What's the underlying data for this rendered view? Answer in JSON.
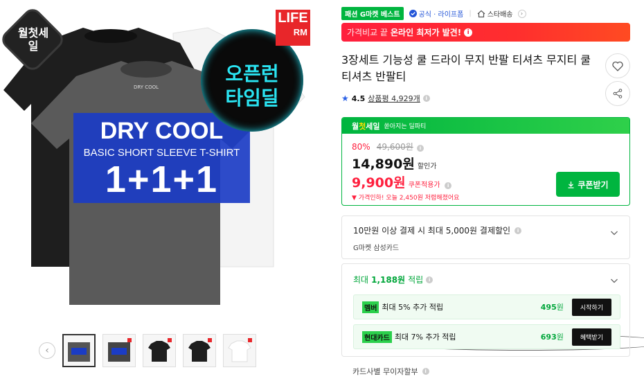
{
  "product_image": {
    "badge_main": "월첫세일",
    "badge_alarm_line1": "오픈런",
    "badge_alarm_line2": "타임딜",
    "brand_corner_top": "LIFE",
    "brand_corner_bottom": "RM",
    "banner_title": "DRY COOL",
    "banner_subtitle": "BASIC SHORT SLEEVE T-SHIRT",
    "banner_deal": "1+1+1",
    "shirt_print": "DRY COOL"
  },
  "thumbnails": {
    "count": 5,
    "selected_index": 0
  },
  "badges": {
    "best": "패션 G마켓 베스트",
    "official": "공식 · 라이프폼",
    "store": "스타배송"
  },
  "price_banner": {
    "prefix": "가격비교 끝",
    "headline": "온라인 최저가 발견!"
  },
  "product_title": "3장세트 기능성 쿨 드라이 무지 반팔 티셔츠 무지티 쿨 티셔츠 반팔티",
  "rating": {
    "score": "4.5",
    "reviews": "상품평 4,929개"
  },
  "deal": {
    "header_w": "월",
    "header_y": "첫",
    "header_rest": "세일",
    "header_sub": "쏟아지는 딜파티",
    "discount": "80%",
    "original": "49,600원",
    "sale_price": "14,890원",
    "sale_label": "할인가",
    "coupon_price": "9,900원",
    "coupon_label": "쿠폰적용가",
    "drop_note": "가격인하! 오늘 2,450원 저렴해졌어요",
    "coupon_button": "쿠폰받기"
  },
  "payment": {
    "line1": "10만원 이상 결제 시 최대 5,000원 결제할인",
    "line2": "G마켓 삼성카드"
  },
  "points": {
    "header_prefix": "최대",
    "header_amount": "1,188원",
    "header_suffix": "적립",
    "rows": [
      {
        "tag": "멤버",
        "desc": "최대 5% 추가 적립",
        "amount": "495",
        "unit": "원",
        "button": "시작하기"
      },
      {
        "tag": "현대카드",
        "desc": "최대 7% 추가 적립",
        "amount": "693",
        "unit": "원",
        "button": "혜택받기"
      }
    ]
  },
  "card_installment": "카드사별 무이자할부",
  "colors": {
    "accent_green": "#00b53f",
    "accent_red": "#ff1f3d",
    "official_blue": "#2456d8"
  }
}
